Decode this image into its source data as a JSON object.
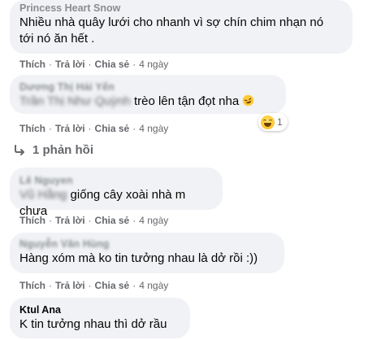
{
  "comments": [
    {
      "author": "Princess Heart Snow",
      "line1": "Nhiều nhà quây lưới cho nhanh vì sợ chín chim nhạn nó",
      "line2": "tới nó ăn hết ."
    },
    {
      "author": "Dương Thị Hải Yến",
      "mention": "Trần Thị Như Quỳnh",
      "text": "trèo lên tận đọt nha"
    },
    {
      "author": "Lê Nguyen",
      "mention": "Vũ Hằng",
      "text": "giống cây xoài nhà m chưa"
    },
    {
      "author": "Nguyễn Văn Hùng",
      "text": "Hàng xóm mà ko tin tưởng nhau là dở rồi :))"
    },
    {
      "author": "Ktul Ana",
      "text": "K tin tưởng nhau thì dở rầu"
    }
  ],
  "actions": {
    "like": "Thích",
    "reply": "Trả lời",
    "share": "Chia sẻ",
    "separator": "·",
    "time": "4 ngày"
  },
  "reaction": {
    "icon": "haha-icon",
    "count": "1"
  },
  "replies_link": "1 phản hồi",
  "colors": {
    "bubble": "#f0f2f5",
    "secondary_text": "#65676b",
    "primary_text": "#050505"
  }
}
